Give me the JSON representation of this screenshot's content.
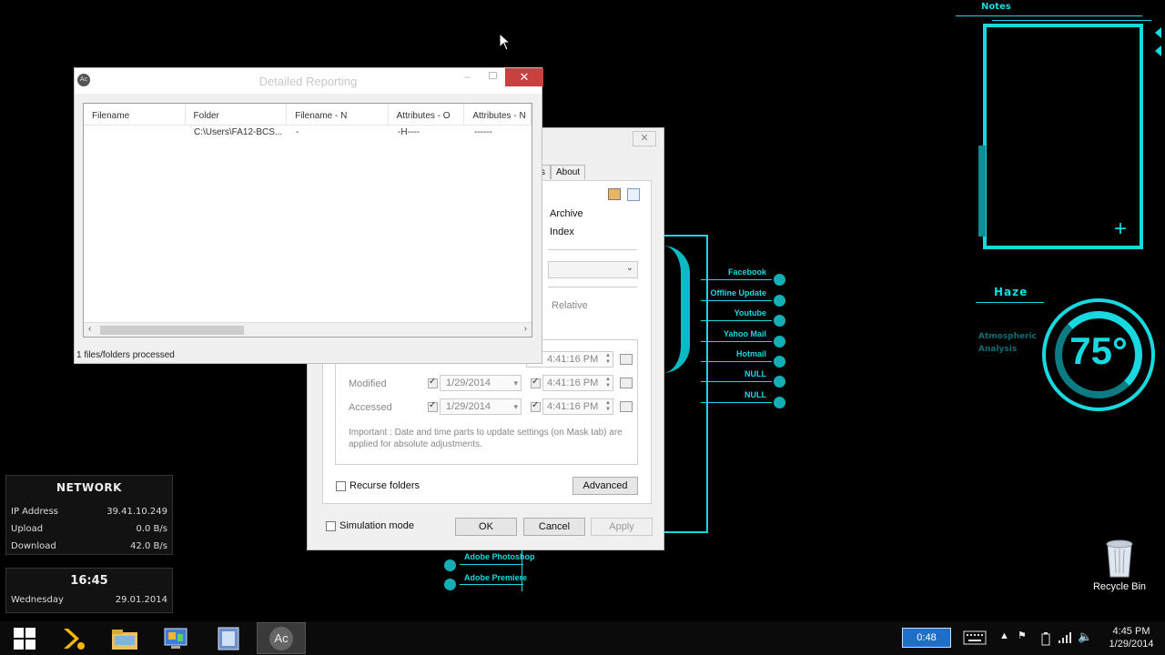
{
  "hud": {
    "notes_title": "Notes",
    "haze_title": "Haze",
    "atmospheric_line1": "Atmospheric",
    "atmospheric_line2": "Analysis",
    "gauge_value": "75°",
    "links": [
      "Facebook",
      "Offline Update",
      "Youtube",
      "Yahoo Mail",
      "Hotmail",
      "NULL",
      "NULL"
    ],
    "adobe_links": [
      "Adobe Photoshop",
      "Adobe Premiere"
    ],
    "accent_color": "#19d9e0"
  },
  "network": {
    "title": "NETWORK",
    "rows": [
      {
        "label": "IP Address",
        "value": "39.41.10.249"
      },
      {
        "label": "Upload",
        "value": "0.0 B/s"
      },
      {
        "label": "Download",
        "value": "42.0 B/s"
      }
    ]
  },
  "clock_widget": {
    "time": "16:45",
    "day": "Wednesday",
    "date": "29.01.2014"
  },
  "main_window": {
    "close_glyph": "✕",
    "tab_partial": "s",
    "tab_about": "About",
    "attr_archive": "Archive",
    "attr_index": "Index",
    "relative_label": "Relative",
    "created_time": "4:41:16 PM",
    "modified_label": "Modified",
    "modified_date": "1/29/2014",
    "modified_time": "4:41:16 PM",
    "accessed_label": "Accessed",
    "accessed_date": "1/29/2014",
    "accessed_time": "4:41:16 PM",
    "important_note": "Important : Date and time parts to update settings (on Mask tab) are applied for absolute adjustments.",
    "recurse_label": "Recurse folders",
    "advanced_label": "Advanced",
    "simulation_label": "Simulation mode",
    "ok_label": "OK",
    "cancel_label": "Cancel",
    "apply_label": "Apply"
  },
  "report_window": {
    "title": "Detailed Reporting",
    "app_icon_text": "Ac",
    "close_glyph": "✕",
    "columns": [
      "Filename",
      "Folder",
      "Filename - N",
      "Attributes - O",
      "Attributes - N"
    ],
    "rows": [
      [
        "",
        "C:\\Users\\FA12-BCS...",
        "-",
        "-H----",
        "------"
      ]
    ],
    "status": "1 files/folders processed"
  },
  "desktop": {
    "recycle_bin_label": "Recycle Bin"
  },
  "taskbar": {
    "apps": [
      "start",
      "plex",
      "file-explorer",
      "control-panel",
      "video",
      "attribute-changer"
    ],
    "active_app_text": "Ac",
    "timer": "0:48",
    "time": "4:45 PM",
    "date": "1/29/2014"
  }
}
